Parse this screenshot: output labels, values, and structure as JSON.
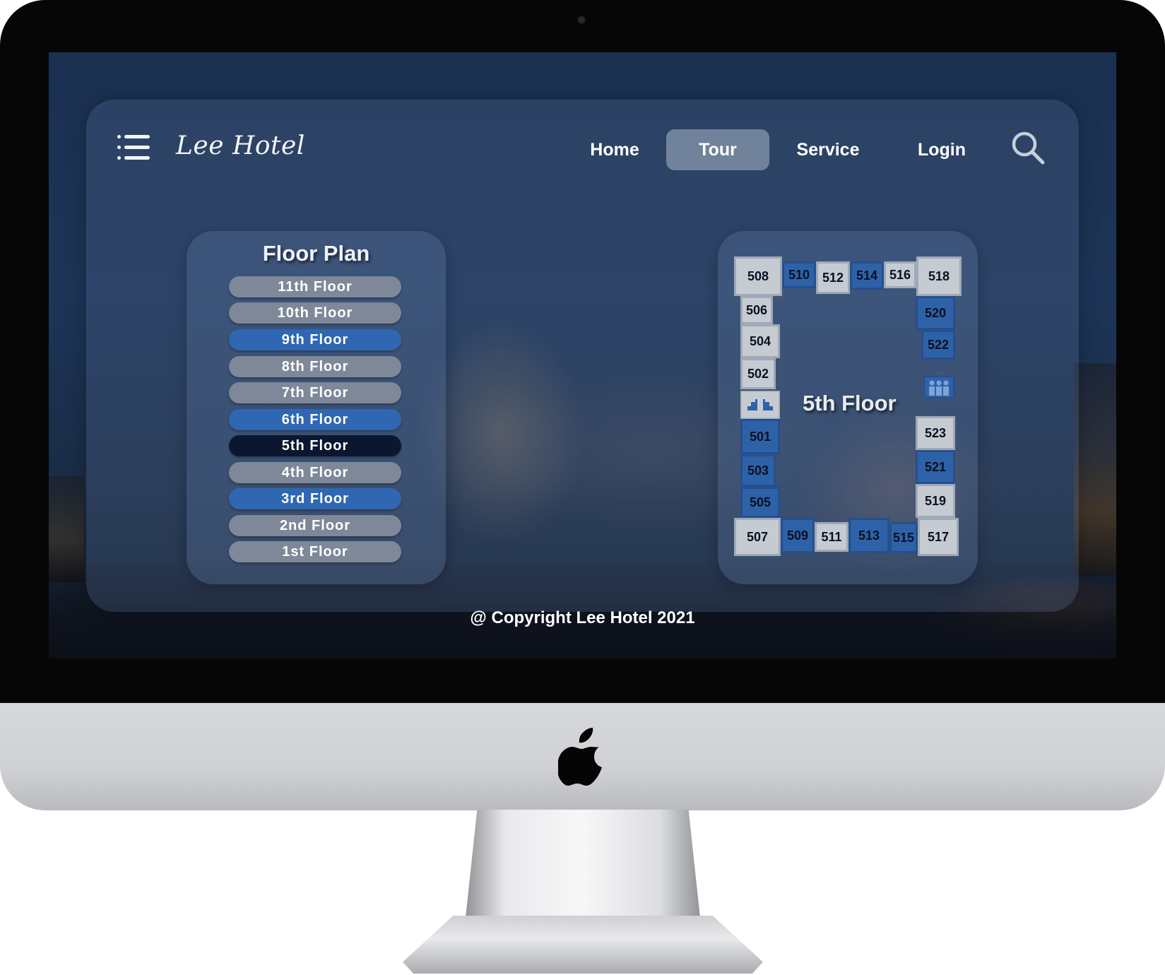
{
  "app": {
    "brand": "Lee Hotel"
  },
  "nav": {
    "items": [
      {
        "label": "Home",
        "active": false
      },
      {
        "label": "Tour",
        "active": true
      },
      {
        "label": "Service",
        "active": false
      },
      {
        "label": "Login",
        "active": false
      }
    ]
  },
  "icons": {
    "menu": "hamburger-menu-icon",
    "search": "search-icon",
    "stairs": "stairs-icon",
    "elevator": "elevator-icon",
    "device": "apple-logo-icon"
  },
  "floor_plan": {
    "title": "Floor Plan",
    "floors": [
      {
        "label": "11th Floor",
        "state": "gray"
      },
      {
        "label": "10th Floor",
        "state": "gray"
      },
      {
        "label": "9th Floor",
        "state": "blue"
      },
      {
        "label": "8th Floor",
        "state": "gray"
      },
      {
        "label": "7th Floor",
        "state": "gray"
      },
      {
        "label": "6th Floor",
        "state": "blue"
      },
      {
        "label": "5th Floor",
        "state": "selected"
      },
      {
        "label": "4th Floor",
        "state": "gray"
      },
      {
        "label": "3rd Floor",
        "state": "blue"
      },
      {
        "label": "2nd Floor",
        "state": "gray"
      },
      {
        "label": "1st Floor",
        "state": "gray"
      }
    ]
  },
  "floor_map": {
    "title": "5th Floor",
    "rooms": {
      "r508": "508",
      "r510": "510",
      "r512": "512",
      "r514": "514",
      "r516": "516",
      "r518": "518",
      "r506": "506",
      "r504": "504",
      "r502": "502",
      "r501": "501",
      "r503": "503",
      "r505": "505",
      "r507": "507",
      "r509": "509",
      "r511": "511",
      "r513": "513",
      "r515": "515",
      "r517": "517",
      "r520": "520",
      "r522": "522",
      "r523": "523",
      "r521": "521",
      "r519": "519"
    }
  },
  "colors": {
    "floor_gray": "#7e8898",
    "floor_blue": "#2f67b3",
    "floor_selected": "#0b1630",
    "room_light": "#c6cbd2",
    "room_blue": "#2e62a8"
  },
  "footer": {
    "text": "@ Copyright Lee Hotel 2021"
  }
}
